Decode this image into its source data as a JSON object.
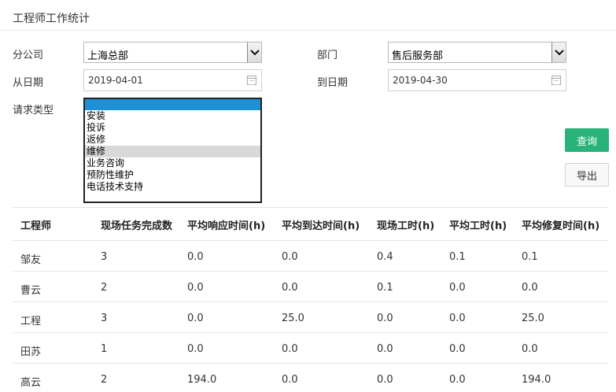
{
  "page": {
    "title": "工程师工作统计"
  },
  "form": {
    "company_label": "分公司",
    "company_value": "上海总部",
    "department_label": "部门",
    "department_value": "售后服务部",
    "from_date_label": "从日期",
    "from_date_value": "2019-04-01",
    "to_date_label": "到日期",
    "to_date_value": "2019-04-30",
    "request_type_label": "请求类型",
    "request_type_options": [
      "",
      "安装",
      "投诉",
      "返修",
      "维修",
      "业务咨询",
      "预防性维护",
      "电话技术支持"
    ],
    "query_button": "查询",
    "export_button": "导出"
  },
  "table": {
    "headers": [
      "工程师",
      "现场任务完成数",
      "平均响应时间(h)",
      "平均到达时间(h)",
      "现场工时(h)",
      "平均工时(h)",
      "平均修复时间(h)"
    ],
    "rows": [
      [
        "邹友",
        "3",
        "0.0",
        "0.0",
        "0.4",
        "0.1",
        "0.1"
      ],
      [
        "曹云",
        "2",
        "0.0",
        "0.0",
        "0.1",
        "0.0",
        "0.0"
      ],
      [
        "工程",
        "3",
        "0.0",
        "25.0",
        "0.0",
        "0.0",
        "25.0"
      ],
      [
        "田苏",
        "1",
        "0.0",
        "0.0",
        "0.0",
        "0.0",
        "0.0"
      ],
      [
        "高云",
        "2",
        "194.0",
        "0.0",
        "0.0",
        "0.0",
        "194.0"
      ]
    ]
  },
  "colors": {
    "accent": "#2ab27b",
    "list_selected": "#1e90d6",
    "list_highlight": "#d9d9d9"
  }
}
